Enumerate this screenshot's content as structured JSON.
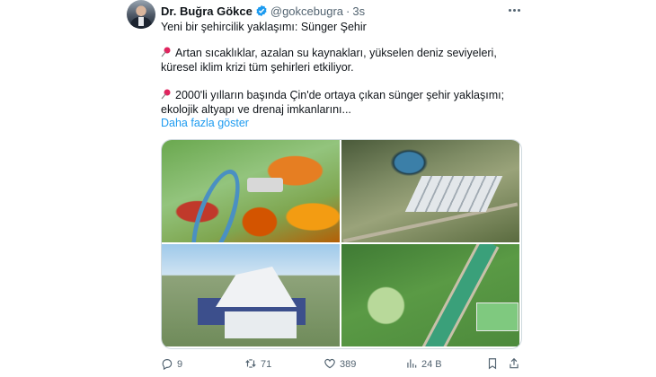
{
  "tweet": {
    "author": {
      "name": "Dr. Buğra Gökce",
      "handle": "@gokcebugra",
      "time": "3s"
    },
    "paragraphs": {
      "p1": "Yeni bir şehircilik yaklaşımı: Sünger Şehir",
      "p2": "Artan sıcaklıklar, azalan su kaynakları, yükselen deniz seviyeleri, küresel iklim krizi tüm şehirleri etkiliyor.",
      "p3": "2000'li yılların başında Çin'de ortaya çıkan sünger şehir yaklaşımı; ekolojik altyapı ve drenaj imkanlarını..."
    },
    "show_more": "Daha fazla göster",
    "separator": "·",
    "actions": {
      "replies": "9",
      "reposts": "71",
      "likes": "389",
      "views": "24 B"
    }
  },
  "colors": {
    "accent": "#1d9bf0",
    "text_secondary": "#536471",
    "pin": "#e0245e"
  },
  "icons": [
    "verified-badge-icon",
    "more-options-icon",
    "pin-icon",
    "reply-icon",
    "repost-icon",
    "like-icon",
    "views-icon",
    "bookmark-icon",
    "share-icon"
  ]
}
